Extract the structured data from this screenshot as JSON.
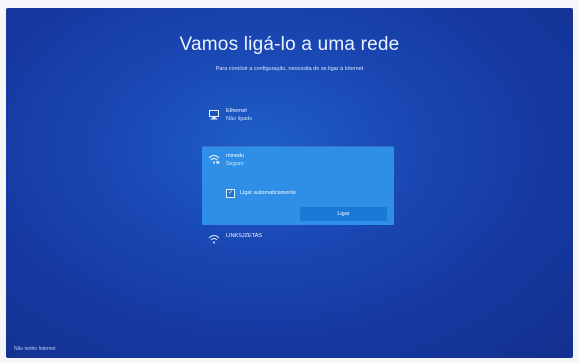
{
  "page": {
    "title": "Vamos ligá-lo a uma rede",
    "subtitle": "Para concluir a configuração, necessita de se ligar à Internet"
  },
  "networks": [
    {
      "name": "Ethernet",
      "status": "Não ligado",
      "icon": "ethernet-icon"
    },
    {
      "name": "minedu",
      "status": "Seguro",
      "icon": "wifi-icon"
    },
    {
      "name": "LINKSJZETAS",
      "status": "",
      "icon": "wifi-icon"
    }
  ],
  "selected_network": {
    "auto_connect_label": "Ligar automaticamente",
    "connect_label": "Ligar"
  },
  "footer": {
    "no_internet": "Não tenho Internet"
  },
  "colors": {
    "background": "#1638a0",
    "selected": "#2f8fe6",
    "button": "#1979d6"
  }
}
